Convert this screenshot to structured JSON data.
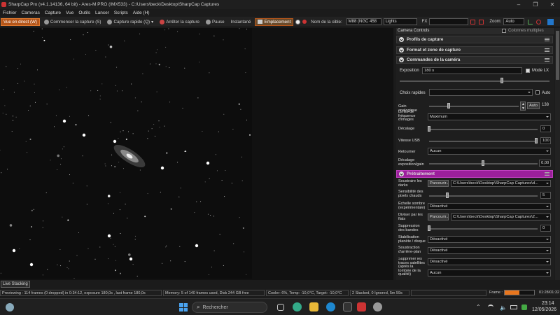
{
  "window": {
    "title": "SharpCap Pro (v4.1.14136, 64 bit) - Ares-M PRO (IMX533) - C:\\Users\\beck\\Desktop\\SharpCap Captures"
  },
  "menu": [
    "Fichier",
    "Cameras",
    "Capture",
    "Vue",
    "Outils",
    "Lancer",
    "Scripts",
    "Aide (H)"
  ],
  "toolbar": {
    "live_view": "Vue en direct (W)",
    "start_capture": "Commencer la capture (S)",
    "quick_capture": "Capture rapide (Q)",
    "stop_capture": "Arrêter la capture",
    "pause": "Pause",
    "snapshot": "Instantané",
    "placement": "Emplacement",
    "target_label": "Nom de la cible:",
    "target_value": "M88 (NGC 458",
    "frame_type": "Lights",
    "fx_label": "FX",
    "fx_value": "",
    "zoom_label": "Zoom:",
    "zoom_value": "Auto"
  },
  "panel": {
    "header": "Camera Controls",
    "multi_columns": "Colonnes multiples",
    "sections": {
      "profiles": "Profils de capture",
      "format": "Format et zone de capture",
      "camera": "Commandes de la caméra",
      "preprocess": "Prétraitement"
    },
    "exposure_label": "Exposition",
    "exposure_value": "180 s",
    "mode_lx": "Mode LX",
    "quick_choice": "Choix rapides",
    "auto": "Auto",
    "gain_label": "Gain analogique",
    "gain_value": "138",
    "gain_auto": "Auto",
    "fps_label": "Limite de fréquence d'images",
    "fps_value": "Maximum",
    "offset_label": "Décalage",
    "offset_value": "0",
    "usb_label": "Vitesse USB",
    "usb_value": "100",
    "flip_label": "Retourner",
    "flip_value": "Aucun",
    "shift_label": "Décalage exposition/gain",
    "shift_value": "0,00",
    "darks_label": "Soustraire les darks",
    "browse": "Parcourir...",
    "darks_path": "C:\\Users\\beck\\Desktop\\SharpCap Captures\\d...",
    "hotpix_label": "Sensibilité des pixels chauds",
    "hotpix_value": "5",
    "darkscale_label": "Échelle sombre (expérimentale)",
    "darkscale_value": "Désactivé",
    "flats_label": "Diviser par les flats",
    "flats_path": "C:\\Users\\beck\\Desktop\\SharpCap Captures\\2...",
    "banding_label": "Suppression des bandes",
    "banding_value": "0",
    "stab_label": "Stabilisation planète / disque",
    "stab_value": "Désactivé",
    "bg_label": "Soustraction d'arrière-plan",
    "bg_value": "Désactivé",
    "sat_label": "Supprimer les traces satellites (après la tombée de la qualité)",
    "sat_value": "Désactivé",
    "last_value": "Aucun"
  },
  "live_stacking": "Live Stacking",
  "status": {
    "previewing": "Previewing : 114 frames (0 dropped) in 0:34:12, exposure 180,0s , last frame 180,0s",
    "memory": "Memory: 5 of 140 frames used, Disk 244 GB free",
    "cooler": "Cooler: 6%, Temp: -10,0°C, Target: -10,0°C",
    "stacked": "2 Stacked, 0 Ignored, 5m 59s",
    "frame_label": "Frame :",
    "frame_progress": 0.5,
    "frame_time": "01:28/01:32"
  },
  "taskbar": {
    "search": "Rechercher",
    "time": "23:14",
    "date": "12/05/2026"
  },
  "colors": {
    "accent": "#b5561a",
    "preprocess": "#9b1f9b",
    "progress": "#e8761e"
  }
}
